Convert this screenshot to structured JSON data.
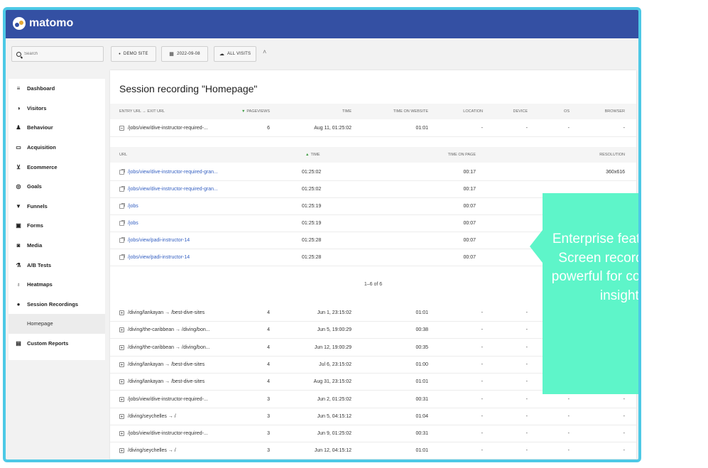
{
  "app": {
    "logo_text": "matomo"
  },
  "search": {
    "placeholder": "Search"
  },
  "toolbar": {
    "site": "DEMO SITE",
    "date": "2022-09-08",
    "segment": "ALL VISITS"
  },
  "sidebar": {
    "items": [
      {
        "label": "Dashboard",
        "icon": "list-icon"
      },
      {
        "label": "Visitors",
        "icon": "visitors-icon"
      },
      {
        "label": "Behaviour",
        "icon": "bell-icon"
      },
      {
        "label": "Acquisition",
        "icon": "window-icon"
      },
      {
        "label": "Ecommerce",
        "icon": "cart-icon"
      },
      {
        "label": "Goals",
        "icon": "target-icon"
      },
      {
        "label": "Funnels",
        "icon": "funnel-icon"
      },
      {
        "label": "Forms",
        "icon": "form-icon"
      },
      {
        "label": "Media",
        "icon": "media-icon"
      },
      {
        "label": "A/B Tests",
        "icon": "flask-icon"
      },
      {
        "label": "Heatmaps",
        "icon": "flame-icon"
      },
      {
        "label": "Session Recordings",
        "icon": "record-icon"
      },
      {
        "label": "Homepage",
        "icon": ""
      },
      {
        "label": "Custom Reports",
        "icon": "report-icon"
      }
    ]
  },
  "main": {
    "title": "Session recording \"Homepage\"",
    "columns": [
      "ENTRY URL → EXIT URL",
      "PAGEVIEWS",
      "TIME",
      "TIME ON WEBSITE",
      "LOCATION",
      "DEVICE",
      "OS",
      "BROWSER"
    ],
    "expanded_session": {
      "url": "/jobs/view/dive-instructor-required-...",
      "pageviews": "6",
      "time": "Aug 11, 01:25:02",
      "time_on_website": "01:01",
      "location": "-",
      "device": "-",
      "os": "-",
      "browser": "-"
    },
    "sub_columns": [
      "URL",
      "TIME",
      "TIME ON PAGE",
      "RESOLUTION"
    ],
    "sub_rows": [
      {
        "url": "/jobs/view/dive-instructor-required-gran...",
        "time": "01:25:02",
        "time_on_page": "00:17",
        "resolution": "360x616"
      },
      {
        "url": "/jobs/view/dive-instructor-required-gran...",
        "time": "01:25:02",
        "time_on_page": "00:17",
        "resolution": ""
      },
      {
        "url": "/jobs",
        "time": "01:25:19",
        "time_on_page": "00:07",
        "resolution": ""
      },
      {
        "url": "/jobs",
        "time": "01:25:19",
        "time_on_page": "00:07",
        "resolution": ""
      },
      {
        "url": "/jobs/view/padi-instructor-14",
        "time": "01:25:28",
        "time_on_page": "00:07",
        "resolution": ""
      },
      {
        "url": "/jobs/view/padi-instructor-14",
        "time": "01:25:28",
        "time_on_page": "00:07",
        "resolution": ""
      }
    ],
    "pagination": "1–6 of 6",
    "sessions": [
      {
        "url": "/diving/lankayan → /best-dive-sites",
        "pageviews": "4",
        "time": "Jun 1, 23:15:02",
        "time_on_website": "01:01",
        "location": "-",
        "device": "-",
        "os": "",
        "browser": ""
      },
      {
        "url": "/diving/the-caribbean → /diving/bon...",
        "pageviews": "4",
        "time": "Jun 5, 19:00:29",
        "time_on_website": "00:38",
        "location": "-",
        "device": "-",
        "os": "",
        "browser": ""
      },
      {
        "url": "/diving/the-caribbean → /diving/bon...",
        "pageviews": "4",
        "time": "Jun 12, 19:00:29",
        "time_on_website": "00:35",
        "location": "-",
        "device": "-",
        "os": "",
        "browser": ""
      },
      {
        "url": "/diving/lankayan → /best-dive-sites",
        "pageviews": "4",
        "time": "Jul 6, 23:15:02",
        "time_on_website": "01:00",
        "location": "-",
        "device": "-",
        "os": "",
        "browser": ""
      },
      {
        "url": "/diving/lankayan → /best-dive-sites",
        "pageviews": "4",
        "time": "Aug 31, 23:15:02",
        "time_on_website": "01:01",
        "location": "-",
        "device": "-",
        "os": "",
        "browser": ""
      },
      {
        "url": "/jobs/view/dive-instructor-required-...",
        "pageviews": "3",
        "time": "Jun 2, 01:25:02",
        "time_on_website": "00:31",
        "location": "-",
        "device": "-",
        "os": "-",
        "browser": "-"
      },
      {
        "url": "/diving/seychelles → /",
        "pageviews": "3",
        "time": "Jun 5, 04:15:12",
        "time_on_website": "01:04",
        "location": "-",
        "device": "-",
        "os": "-",
        "browser": "-"
      },
      {
        "url": "/jobs/view/dive-instructor-required-...",
        "pageviews": "3",
        "time": "Jun 9, 01:25:02",
        "time_on_website": "00:31",
        "location": "-",
        "device": "-",
        "os": "-",
        "browser": "-"
      },
      {
        "url": "/diving/seychelles → /",
        "pageviews": "3",
        "time": "Jun 12, 04:15:12",
        "time_on_website": "01:01",
        "location": "-",
        "device": "-",
        "os": "-",
        "browser": "-"
      }
    ]
  },
  "callout": {
    "text": "Enterprise features like Screen recording are powerful for conversion insight."
  },
  "colors": {
    "topbar": "#3450a3",
    "frame": "#4dc9e6",
    "callout": "#5ef5c9",
    "link": "#3560c2",
    "sort_arrow": "#43a047"
  }
}
